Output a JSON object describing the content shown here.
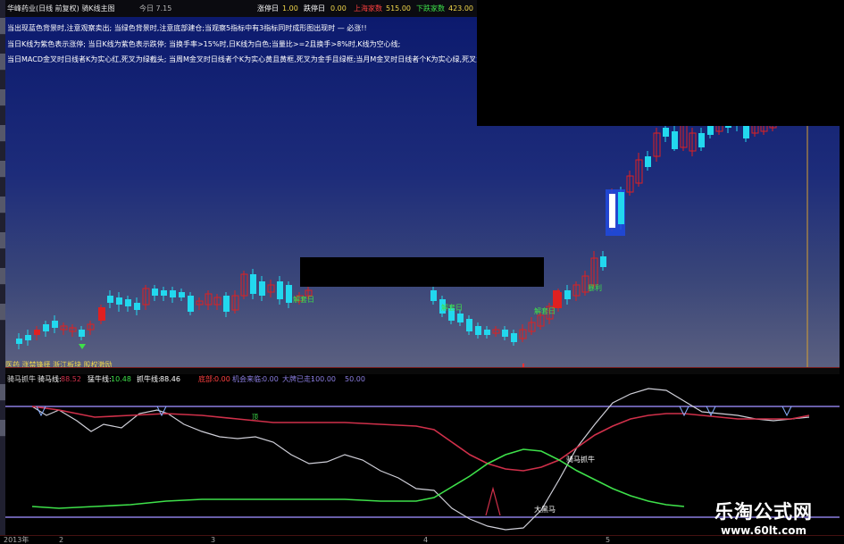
{
  "top_bar": {
    "title": "华峰药业(日线 前复权) 骑K线主图",
    "yest_label": "今日 7.15",
    "board_label": "涨停日",
    "board_value": "1.00",
    "drop_label": "跌停日",
    "drop_value": "0.00",
    "sh_label": "上海家数",
    "sh_value": "515.00",
    "down_label": "下跌家数",
    "down_value": "423.00"
  },
  "notes": [
    "当出现蓝色背景时,注意观察卖出; 当绿色背景时,注意底部建仓;当观察5指标中有3指标同时成形图出现时 — 必涨!!",
    "当日K线为紫色表示涨停; 当日K线为紫色表示跌停; 当换手率>15%时,日K线为白色;当量比>=2且换手>8%时,K线为空心线;",
    "当日MACD金叉时日线者K为实心红,死叉为绿截头; 当周M金叉时日线者个K为实心黄且黄框,死叉为金手且绿框;当月M金叉时日线者个K为实心绿,死叉为金"
  ],
  "markers": {
    "jiedi_1": "解套日",
    "jiedi_2": "解套日",
    "jiedi_3": "解套日",
    "baoli": "暴利"
  },
  "bottom_labels": "医药 涨禁锋择 浙江板块 股权激励",
  "indicator": {
    "name": "骑马抓牛",
    "l1_label": "骑马线:",
    "l1_value": "88.52",
    "l2_label": "猛牛线:",
    "l2_value": "10.48",
    "l3_label": "抓牛线:",
    "l3_value": "88.46",
    "l4_label": "底部:",
    "l4_value": "0.00",
    "l5_label": "机会来临:",
    "l5_value": "0.00",
    "l6_label": "大牌已走:",
    "l6_value": "100.00",
    "l7_label": "",
    "l7_value": "50.00",
    "label_cross": "骑马抓牛",
    "label_bottom": "大黑马",
    "label_top": "顶"
  },
  "dates": [
    "2013年",
    "2",
    "3",
    "4",
    "5"
  ],
  "watermark": {
    "title": "乐淘公式网",
    "url": "www.60lt.com"
  },
  "colors": {
    "up": "#e02020",
    "down": "#22d8ee",
    "white_line": "#cfcfd8",
    "red_line": "#d0304a",
    "green_line": "#3ee04a",
    "band": "#8a7de0"
  }
}
